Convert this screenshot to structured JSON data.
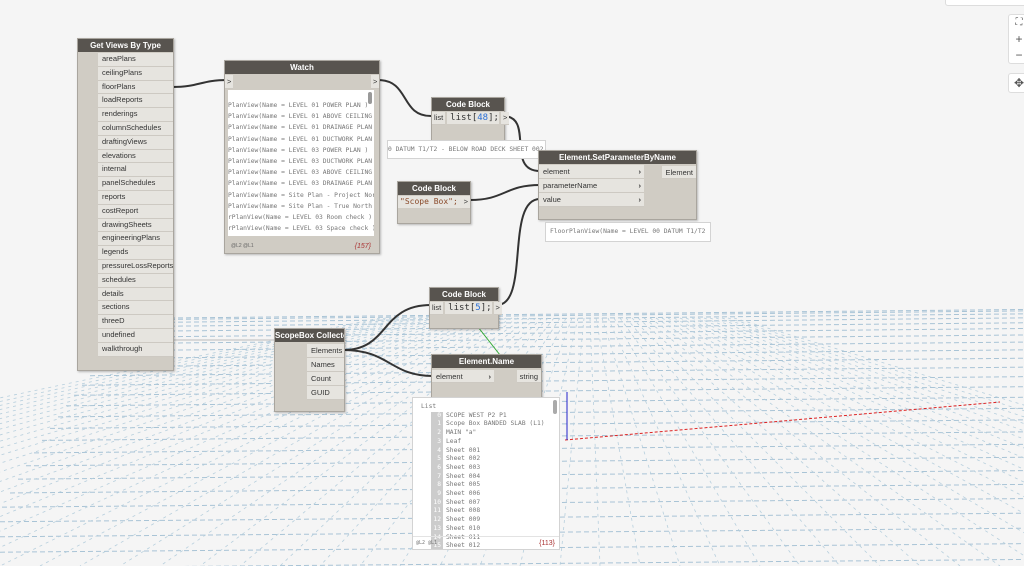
{
  "get_views": {
    "title": "Get Views By Type",
    "outputs": [
      "areaPlans",
      "ceilingPlans",
      "floorPlans",
      "loadReports",
      "renderings",
      "columnSchedules",
      "draftingViews",
      "elevations",
      "internal",
      "panelSchedules",
      "reports",
      "costReport",
      "drawingSheets",
      "engineeringPlans",
      "legends",
      "pressureLossReports",
      "schedules",
      "details",
      "sections",
      "threeD",
      "undefined",
      "walkthrough"
    ]
  },
  "watch": {
    "title": "Watch",
    "in_port": ">",
    "out_port": ">",
    "lines": [
      "PlanView(Name = LEVEL 01 POWER PLAN )",
      "PlanView(Name = LEVEL 01 ABOVE CEILING",
      "PlanView(Name = LEVEL 01 DRAINAGE PLAN",
      "PlanView(Name = LEVEL 01 DUCTWORK PLAN",
      "PlanView(Name = LEVEL 03 POWER PLAN )",
      "PlanView(Name = LEVEL 03 DUCTWORK PLAN",
      "PlanView(Name = LEVEL 03 ABOVE CEILING",
      "PlanView(Name = LEVEL 03 DRAINAGE PLAN",
      "PlanView(Name = Site Plan - Project Nor",
      "PlanView(Name = Site Plan - True North",
      "rPlanView(Name = LEVEL 03 Room check )",
      "rPlanView(Name = LEVEL 03 Space check )"
    ],
    "levels": "@L2 @L1",
    "count": "{157}"
  },
  "cb48": {
    "title": "Code Block",
    "in_port": "list",
    "code_a": "list[",
    "code_num": "48",
    "code_b": "];",
    "out_port": ">",
    "preview": "0 DATUM T1/T2 - BELOW ROAD DECK SHEET 002 )"
  },
  "cbscope": {
    "title": "Code Block",
    "code": "\"Scope Box\";",
    "out_port": ">"
  },
  "setparam": {
    "title": "Element.SetParameterByName",
    "inputs": [
      "element",
      "parameterName",
      "value"
    ],
    "output": "Element",
    "preview": "FloorPlanView(Name = LEVEL 00 DATUM T1/T2 -"
  },
  "cb5": {
    "title": "Code Block",
    "in_port": "list",
    "code_a": "list[",
    "code_num": "5",
    "code_b": "];",
    "out_port": ">"
  },
  "scopebox": {
    "title": "ScopeBox Collector",
    "outputs": [
      "Elements",
      "Names",
      "Count",
      "GUID"
    ]
  },
  "elname": {
    "title": "Element.Name",
    "input": "element",
    "output": "string",
    "list_label": "List",
    "items": [
      [
        "0",
        "SCOPE WEST P2 P1"
      ],
      [
        "1",
        "Scope Box BANDED SLAB (L1)"
      ],
      [
        "2",
        "MAIN \"a\""
      ],
      [
        "3",
        "Leaf"
      ],
      [
        "4",
        "Sheet 001"
      ],
      [
        "5",
        "Sheet 002"
      ],
      [
        "6",
        "Sheet 003"
      ],
      [
        "7",
        "Sheet 004"
      ],
      [
        "8",
        "Sheet 005"
      ],
      [
        "9",
        "Sheet 006"
      ],
      [
        "10",
        "Sheet 007"
      ],
      [
        "11",
        "Sheet 008"
      ],
      [
        "12",
        "Sheet 009"
      ],
      [
        "13",
        "Sheet 010"
      ],
      [
        "14",
        "Sheet 011"
      ],
      [
        "15",
        "Sheet 012"
      ]
    ],
    "levels": "@L2 @L1",
    "count": "{113}"
  },
  "controls": {
    "fit": "⛶",
    "zoom_in": "+",
    "zoom_out": "−",
    "pan": "✥"
  }
}
